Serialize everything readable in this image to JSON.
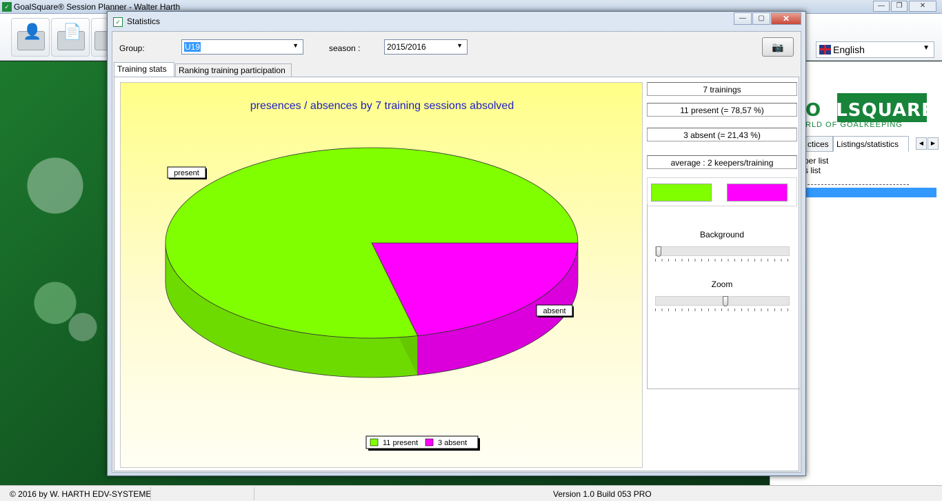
{
  "app": {
    "title": "GoalSquare® Session Planner - Walter Harth",
    "logo_glyph": "✓",
    "language": "English"
  },
  "brand": {
    "word_visible": "ALSQUARE",
    "word_prefix": "O",
    "subtitle": "RLD OF GOALKEEPING"
  },
  "right_panel": {
    "tabs": [
      "ctices",
      "Listings/statistics"
    ],
    "list": [
      "per list",
      "s list"
    ]
  },
  "statusbar": {
    "copyright": "© 2016 by W. HARTH EDV-SYSTEME",
    "version": "Version 1.0 Build 053 PRO"
  },
  "dialog": {
    "title": "Statistics",
    "group_label": "Group:",
    "group_value": "U19",
    "season_label": "season :",
    "season_value": "2015/2016",
    "camera_icon": "camera-icon",
    "tabs": [
      "Training stats",
      "Ranking training participation"
    ]
  },
  "stats": {
    "trainings": "7 trainings",
    "present": "11 present (= 78,57 %)",
    "absent": "3 absent (= 21,43 %)",
    "average": "average : 2 keepers/training",
    "background_label": "Background",
    "zoom_label": "Zoom",
    "background_level": 0.0,
    "zoom_level": 0.5,
    "colors": {
      "present": "#80ff00",
      "absent": "#ff00ff"
    }
  },
  "chart_data": {
    "type": "pie",
    "title": "presences / absences by 7 training sessions absolved",
    "slices": [
      {
        "label": "present",
        "value": 11,
        "color": "#80ff00"
      },
      {
        "label": "absent",
        "value": 3,
        "color": "#ff00ff"
      }
    ],
    "legend": [
      "11  present",
      "3  absent"
    ],
    "legend_position": "bottom"
  }
}
